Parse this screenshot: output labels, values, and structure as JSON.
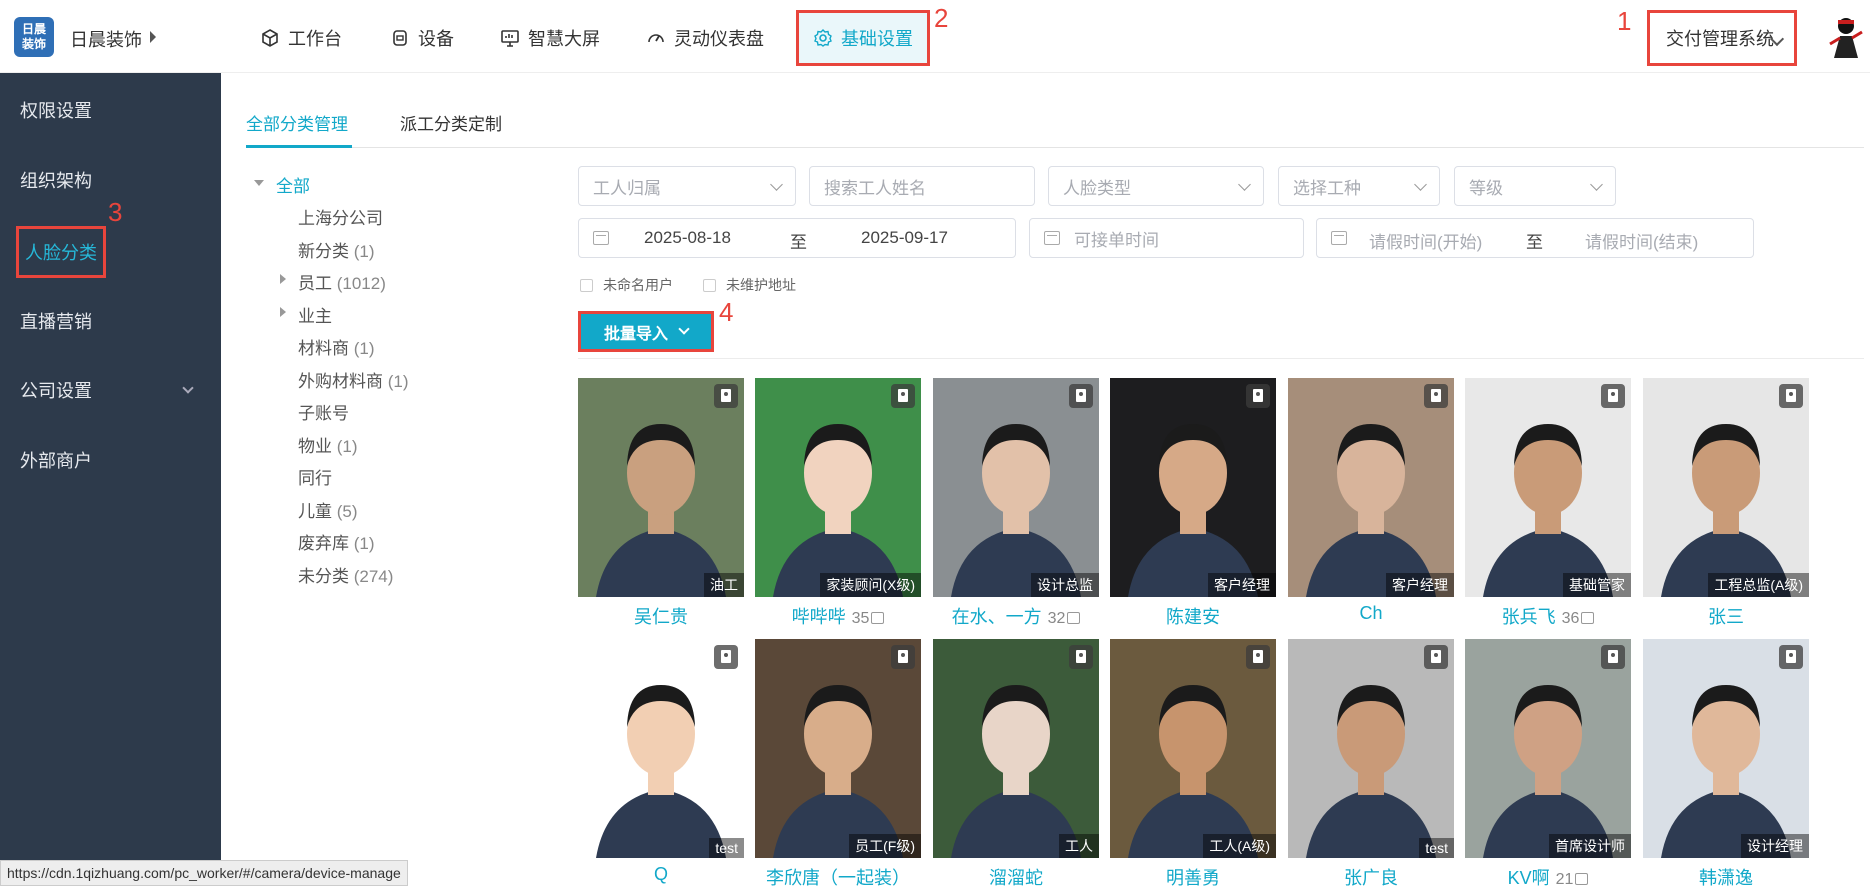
{
  "topbar": {
    "logo_text_1": "日晨",
    "logo_text_2": "装饰",
    "brand": "日晨装饰",
    "nav": [
      {
        "label": "工作台",
        "icon": "cube-icon"
      },
      {
        "label": "设备",
        "icon": "device-icon"
      },
      {
        "label": "智慧大屏",
        "icon": "monitor-icon"
      },
      {
        "label": "灵动仪表盘",
        "icon": "gauge-icon"
      },
      {
        "label": "基础设置",
        "icon": "gear-icon"
      }
    ],
    "system_select": "交付管理系统",
    "annotations": {
      "n1": "1",
      "n2": "2",
      "n3": "3",
      "n4": "4"
    }
  },
  "sidebar": {
    "items": [
      "权限设置",
      "组织架构",
      "人脸分类",
      "直播营销",
      "公司设置",
      "外部商户"
    ]
  },
  "tabs": [
    "全部分类管理",
    "派工分类定制"
  ],
  "tree": {
    "root": "全部",
    "nodes": [
      {
        "label": "上海分公司",
        "count": ""
      },
      {
        "label": "新分类",
        "count": "(1)"
      },
      {
        "label": "员工",
        "count": "(1012)"
      },
      {
        "label": "业主",
        "count": ""
      },
      {
        "label": "材料商",
        "count": "(1)"
      },
      {
        "label": "外购材料商",
        "count": "(1)"
      },
      {
        "label": "子账号",
        "count": ""
      },
      {
        "label": "物业",
        "count": "(1)"
      },
      {
        "label": "同行",
        "count": ""
      },
      {
        "label": "儿童",
        "count": "(5)"
      },
      {
        "label": "废弃库",
        "count": "(1)"
      },
      {
        "label": "未分类",
        "count": "(274)"
      }
    ]
  },
  "filters": {
    "worker_belong": "工人归属",
    "search_name": "搜索工人姓名",
    "face_type": "人脸类型",
    "work_type": "选择工种",
    "level": "等级",
    "date_start": "2025-08-18",
    "date_to": "至",
    "date_end": "2025-09-17",
    "available_time": "可接单时间",
    "leave_start": "请假时间(开始)",
    "leave_to": "至",
    "leave_end": "请假时间(结束)",
    "unnamed_users": "未命名用户",
    "no_address": "未维护地址"
  },
  "batch_import": "批量导入",
  "cards": [
    {
      "name": "吴仁贵",
      "tag": "油工",
      "num": "",
      "bg": "#6b7f5e",
      "skin": "#c9a07f"
    },
    {
      "name": "哔哔哔",
      "tag": "家装顾问(X级)",
      "num": "35",
      "bg": "#3f8f4a",
      "skin": "#f1d3bf"
    },
    {
      "name": "在水、一方",
      "tag": "设计总监",
      "num": "32",
      "bg": "#8a8f92",
      "skin": "#e2c1a9"
    },
    {
      "name": "陈建安",
      "tag": "客户经理",
      "num": "",
      "bg": "#1d1d1f",
      "skin": "#d6a987"
    },
    {
      "name": "Ch",
      "tag": "客户经理",
      "num": "",
      "bg": "#a68e7a",
      "skin": "#d8b49b"
    },
    {
      "name": "张兵飞",
      "tag": "基础管家",
      "num": "36",
      "bg": "#e8e8e8",
      "skin": "#c99b78"
    },
    {
      "name": "张三",
      "tag": "工程总监(A级)",
      "num": "",
      "bg": "#e6e6e6",
      "skin": "#c99b78"
    },
    {
      "name": "Q",
      "tag": "test",
      "num": "",
      "bg": "#ffffff",
      "skin": "#f2cfb3"
    },
    {
      "name": "李欣唐（一起装）",
      "tag": "员工(F级)",
      "num": "",
      "bg": "#5a4838",
      "skin": "#d8ad8a"
    },
    {
      "name": "溜溜蛇",
      "tag": "工人",
      "num": "",
      "bg": "#3c5b3a",
      "skin": "#e8d5c8"
    },
    {
      "name": "明善勇",
      "tag": "工人(A级)",
      "num": "",
      "bg": "#6b5a3e",
      "skin": "#c7946d"
    },
    {
      "name": "张广良",
      "tag": "test",
      "num": "",
      "bg": "#b9b9b9",
      "skin": "#c99a78"
    },
    {
      "name": "KV啊",
      "tag": "首席设计师",
      "num": "21",
      "bg": "#9aa39e",
      "skin": "#cfa184"
    },
    {
      "name": "韩潇逸",
      "tag": "设计经理",
      "num": "",
      "bg": "#d9dfe6",
      "skin": "#e0b89a"
    }
  ],
  "statusbar": "https://cdn.1qizhuang.com/pc_worker/#/camera/device-manage"
}
